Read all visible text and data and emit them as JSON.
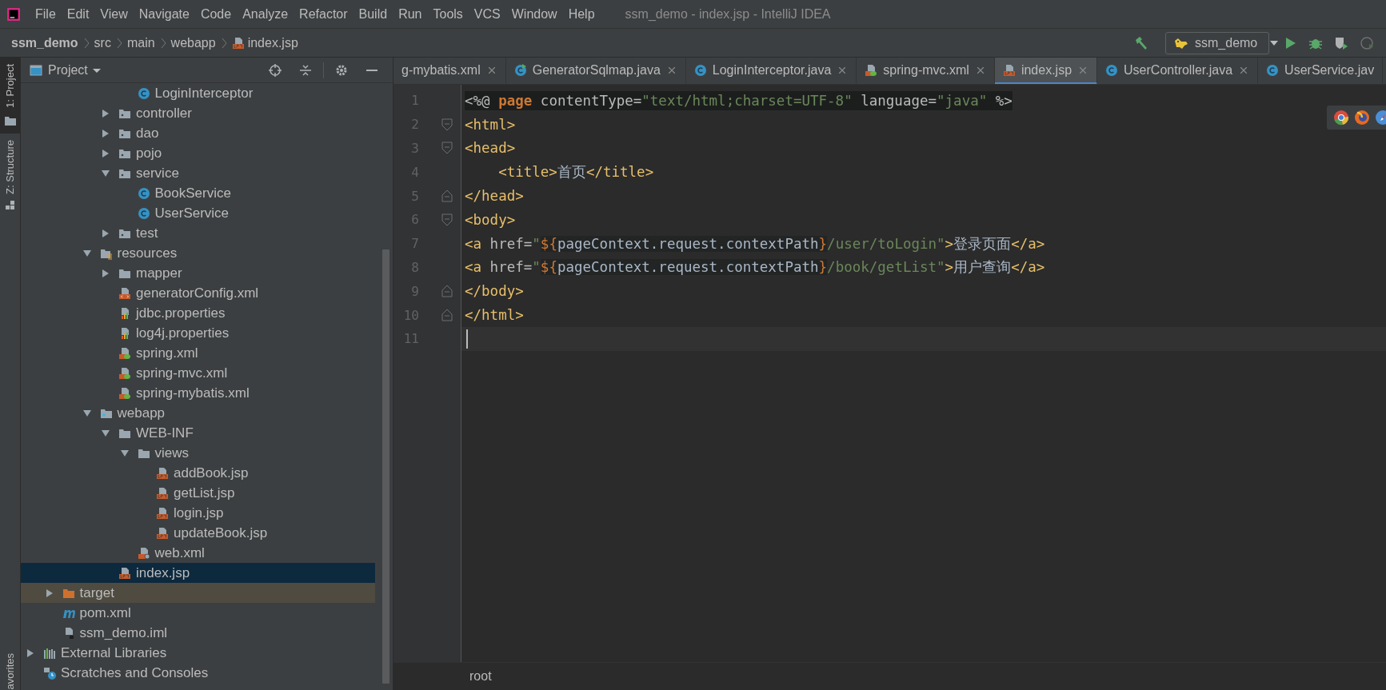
{
  "menu": [
    "File",
    "Edit",
    "View",
    "Navigate",
    "Code",
    "Analyze",
    "Refactor",
    "Build",
    "Run",
    "Tools",
    "VCS",
    "Window",
    "Help"
  ],
  "window": {
    "title": "ssm_demo - index.jsp - IntelliJ IDEA"
  },
  "breadcrumbs": [
    {
      "label": "ssm_demo",
      "kind": "plain"
    },
    {
      "label": "src",
      "kind": "plain"
    },
    {
      "label": "main",
      "kind": "plain"
    },
    {
      "label": "webapp",
      "kind": "plain"
    },
    {
      "label": "index.jsp",
      "kind": "jsp"
    }
  ],
  "run_config": {
    "label": "ssm_demo"
  },
  "side_tabs": [
    {
      "label": "1: Project",
      "selected": true
    },
    {
      "label": "Z: Structure",
      "selected": false
    }
  ],
  "side_tabs_bottom": [
    {
      "label": "avorites",
      "selected": false
    }
  ],
  "project": {
    "title": "Project"
  },
  "tree": [
    {
      "children": [
        {
          "children": [
            {
              "children": [
                {
                  "children": [
                    {
                      "children": [
                        {
                          "label": "LoginInterceptor",
                          "kind": "class",
                          "selected": false
                        }
                      ]
                    },
                    {
                      "label": "controller",
                      "kind": "package",
                      "expanded": false,
                      "selected": false
                    },
                    {
                      "label": "dao",
                      "kind": "package",
                      "expanded": false,
                      "selected": false
                    },
                    {
                      "label": "pojo",
                      "kind": "package",
                      "expanded": false,
                      "selected": false
                    },
                    {
                      "label": "service",
                      "kind": "package",
                      "expanded": true,
                      "selected": false,
                      "children": [
                        {
                          "label": "BookService",
                          "kind": "class",
                          "selected": false
                        },
                        {
                          "label": "UserService",
                          "kind": "class",
                          "selected": false
                        }
                      ]
                    },
                    {
                      "label": "test",
                      "kind": "package",
                      "expanded": false,
                      "selected": false
                    }
                  ]
                },
                {
                  "label": "resources",
                  "kind": "resources",
                  "expanded": true,
                  "selected": false,
                  "children": [
                    {
                      "label": "mapper",
                      "kind": "folder",
                      "expanded": false,
                      "selected": false
                    },
                    {
                      "label": "generatorConfig.xml",
                      "kind": "xml",
                      "selected": false
                    },
                    {
                      "label": "jdbc.properties",
                      "kind": "props",
                      "selected": false
                    },
                    {
                      "label": "log4j.properties",
                      "kind": "props",
                      "selected": false
                    },
                    {
                      "label": "spring.xml",
                      "kind": "spring",
                      "selected": false
                    },
                    {
                      "label": "spring-mvc.xml",
                      "kind": "spring",
                      "selected": false
                    },
                    {
                      "label": "spring-mybatis.xml",
                      "kind": "spring",
                      "selected": false
                    }
                  ]
                },
                {
                  "label": "webapp",
                  "kind": "webapp",
                  "expanded": true,
                  "selected": false,
                  "children": [
                    {
                      "label": "WEB-INF",
                      "kind": "folder",
                      "expanded": true,
                      "selected": false,
                      "children": [
                        {
                          "label": "views",
                          "kind": "folder",
                          "expanded": true,
                          "selected": false,
                          "children": [
                            {
                              "label": "addBook.jsp",
                              "kind": "jsp",
                              "selected": false
                            },
                            {
                              "label": "getList.jsp",
                              "kind": "jsp",
                              "selected": false
                            },
                            {
                              "label": "login.jsp",
                              "kind": "jsp",
                              "selected": false
                            },
                            {
                              "label": "updateBook.jsp",
                              "kind": "jsp",
                              "selected": false
                            }
                          ]
                        },
                        {
                          "label": "web.xml",
                          "kind": "webxml",
                          "selected": false
                        }
                      ]
                    },
                    {
                      "label": "index.jsp",
                      "kind": "jsp",
                      "selected": true
                    }
                  ]
                }
              ]
            }
          ]
        },
        {
          "label": "target",
          "kind": "excluded",
          "expanded": false,
          "selected": false
        },
        {
          "label": "pom.xml",
          "kind": "maven",
          "selected": false
        },
        {
          "label": "ssm_demo.iml",
          "kind": "iml",
          "selected": false
        }
      ]
    },
    {
      "label": "External Libraries",
      "kind": "libraries",
      "expanded": false,
      "selected": false
    },
    {
      "label": "Scratches and Consoles",
      "kind": "scratches",
      "selected": false
    }
  ],
  "tabs": [
    {
      "label": "g-mybatis.xml",
      "kind": "plain",
      "selected": false,
      "closable": true
    },
    {
      "label": "GeneratorSqlmap.java",
      "kind": "runclass",
      "selected": false,
      "closable": true
    },
    {
      "label": "LoginInterceptor.java",
      "kind": "class",
      "selected": false,
      "closable": true
    },
    {
      "label": "spring-mvc.xml",
      "kind": "spring",
      "selected": false,
      "closable": true
    },
    {
      "label": "index.jsp",
      "kind": "jsp",
      "selected": true,
      "closable": true
    },
    {
      "label": "UserController.java",
      "kind": "class",
      "selected": false,
      "closable": true
    },
    {
      "label": "UserService.jav",
      "kind": "class",
      "selected": false,
      "closable": false
    }
  ],
  "code": [
    {
      "number": "1",
      "current": false,
      "shaded": true,
      "kind": "plain",
      "tokens": [
        {
          "text": "<%@ ",
          "kind": "plain"
        },
        {
          "text": "page",
          "kind": "keyword"
        },
        {
          "text": " contentType=",
          "kind": "plain"
        },
        {
          "text": "\"text/html;charset=UTF-8\"",
          "kind": "string"
        },
        {
          "text": " language=",
          "kind": "plain"
        },
        {
          "text": "\"java\"",
          "kind": "string"
        },
        {
          "text": " %>",
          "kind": "plain"
        }
      ]
    },
    {
      "number": "2",
      "current": false,
      "shaded": false,
      "kind": "opener",
      "tokens": [
        {
          "text": "<html>",
          "kind": "tag"
        }
      ]
    },
    {
      "number": "3",
      "current": false,
      "shaded": false,
      "kind": "opener",
      "tokens": [
        {
          "text": "<head>",
          "kind": "tag"
        }
      ]
    },
    {
      "number": "4",
      "current": false,
      "shaded": false,
      "kind": "plain",
      "tokens": [
        {
          "text": "    <title>",
          "kind": "tag"
        },
        {
          "text": "首页",
          "kind": "text"
        },
        {
          "text": "</title>",
          "kind": "tag"
        }
      ]
    },
    {
      "number": "5",
      "current": false,
      "shaded": false,
      "kind": "closer",
      "tokens": [
        {
          "text": "</head>",
          "kind": "tag"
        }
      ]
    },
    {
      "number": "6",
      "current": false,
      "shaded": false,
      "kind": "opener",
      "tokens": [
        {
          "text": "<body>",
          "kind": "tag"
        }
      ]
    },
    {
      "number": "7",
      "current": false,
      "shaded": false,
      "kind": "plain",
      "tokens": [
        {
          "text": "<a",
          "kind": "tag"
        },
        {
          "text": " href=",
          "kind": "plain"
        },
        {
          "text": "\"",
          "kind": "string"
        },
        {
          "text": "${",
          "kind": "el_brace"
        },
        {
          "text": "pageContext.request.contextPath",
          "kind": "el"
        },
        {
          "text": "}",
          "kind": "el_brace"
        },
        {
          "text": "/user/toLogin\"",
          "kind": "string"
        },
        {
          "text": ">",
          "kind": "tag"
        },
        {
          "text": "登录页面",
          "kind": "text"
        },
        {
          "text": "</a>",
          "kind": "tag"
        }
      ]
    },
    {
      "number": "8",
      "current": false,
      "shaded": false,
      "kind": "plain",
      "tokens": [
        {
          "text": "<a",
          "kind": "tag"
        },
        {
          "text": " href=",
          "kind": "plain"
        },
        {
          "text": "\"",
          "kind": "string"
        },
        {
          "text": "${",
          "kind": "el_brace"
        },
        {
          "text": "pageContext.request.contextPath",
          "kind": "el"
        },
        {
          "text": "}",
          "kind": "el_brace"
        },
        {
          "text": "/book/getList\"",
          "kind": "string"
        },
        {
          "text": ">",
          "kind": "tag"
        },
        {
          "text": "用户查询",
          "kind": "text"
        },
        {
          "text": "</a>",
          "kind": "tag"
        }
      ]
    },
    {
      "number": "9",
      "current": false,
      "shaded": false,
      "kind": "closer",
      "tokens": [
        {
          "text": "</body>",
          "kind": "tag"
        }
      ]
    },
    {
      "number": "10",
      "current": false,
      "shaded": false,
      "kind": "closer",
      "tokens": [
        {
          "text": "</html>",
          "kind": "tag"
        }
      ]
    },
    {
      "number": "11",
      "current": true,
      "kind": "plain"
    }
  ],
  "editor_breadcrumb": "root"
}
